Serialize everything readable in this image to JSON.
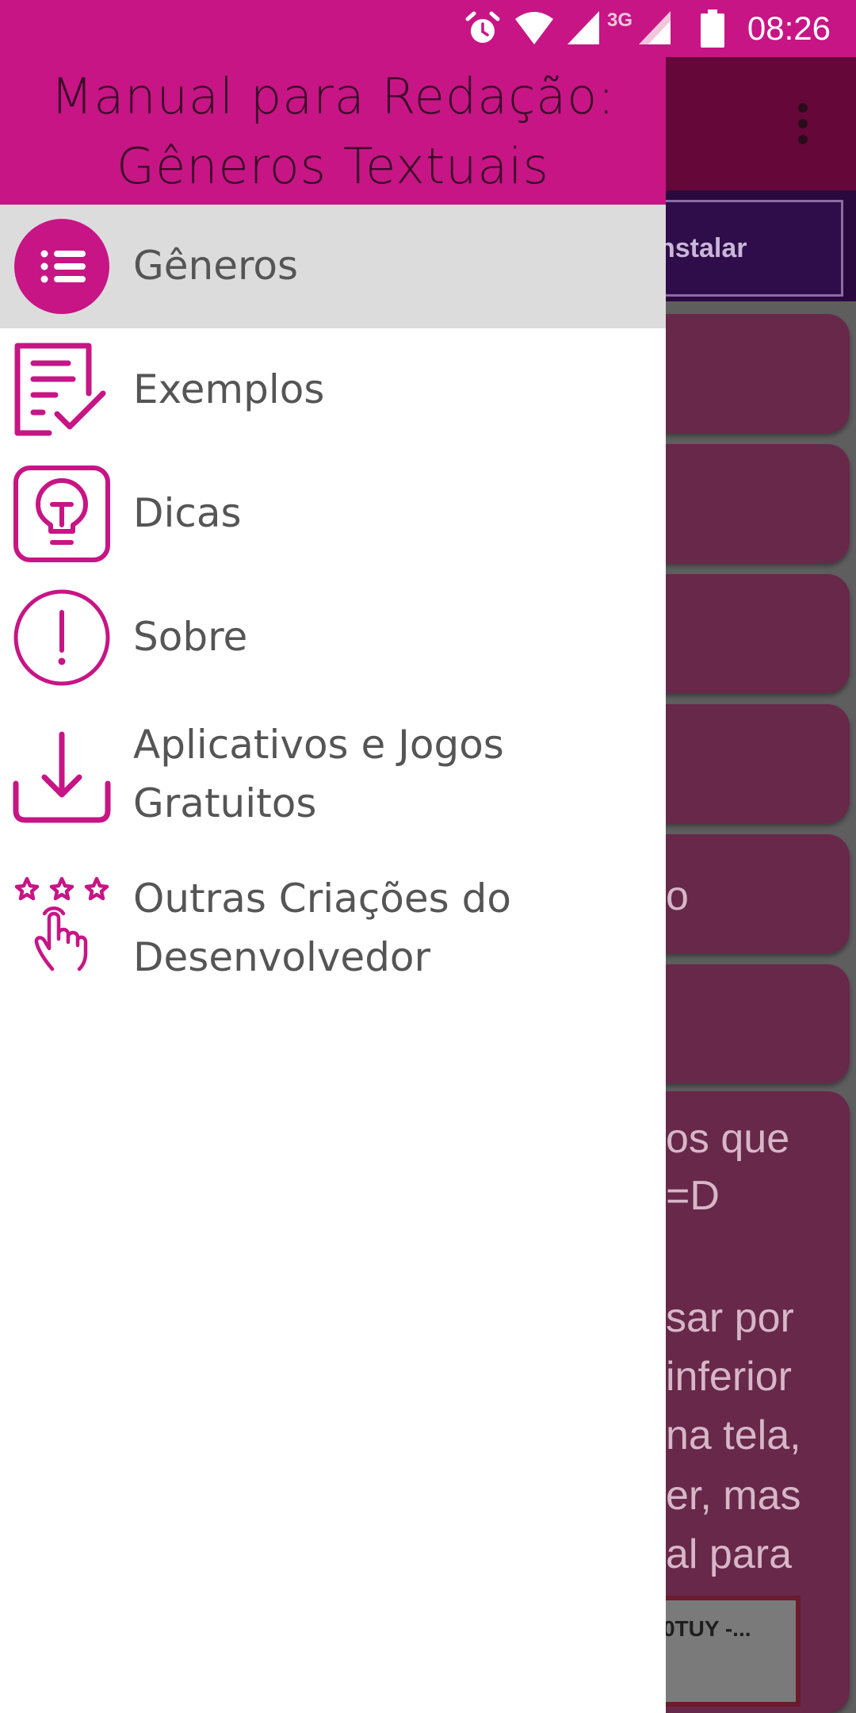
{
  "status_bar": {
    "time": "08:26",
    "network_label": "3G",
    "icons": [
      "alarm-icon",
      "wifi-icon",
      "signal-icon",
      "signal-icon",
      "battery-icon"
    ]
  },
  "drawer": {
    "title_line1": "Manual para Redação:",
    "title_line2": "Gêneros Textuais",
    "items": [
      {
        "label": "Gêneros",
        "icon": "list-icon",
        "active": true
      },
      {
        "label": "Exemplos",
        "icon": "checklist-document-icon",
        "active": false
      },
      {
        "label": "Dicas",
        "icon": "lightbulb-icon",
        "active": false
      },
      {
        "label": "Sobre",
        "icon": "info-exclamation-icon",
        "active": false
      },
      {
        "label": "Aplicativos e Jogos\nGratuitos",
        "icon": "download-icon",
        "active": false
      },
      {
        "label": "Outras Criações do\nDesenvolvedor",
        "icon": "stars-hand-icon",
        "active": false
      }
    ]
  },
  "background": {
    "install_button": "nstalar",
    "text_lines": [
      "o",
      "os que",
      "=D",
      "sar por",
      "inferior",
      "na tela,",
      "er, mas",
      "al para"
    ],
    "ad_text": "0TUY -..."
  },
  "colors": {
    "primary": "#c71585",
    "primary_dark": "#66073a",
    "drawer_active_bg": "#dcdcdc",
    "label_text": "#555555"
  }
}
